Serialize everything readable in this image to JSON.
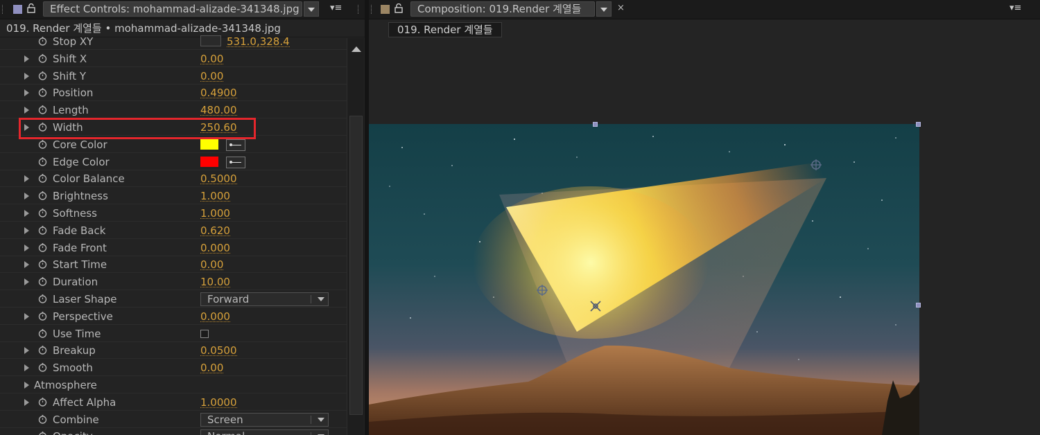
{
  "effect_controls": {
    "tab_title": "Effect Controls: mohammad-alizade-341348.jpg",
    "subheader": "019. Render 계열들 • mohammad-alizade-341348.jpg",
    "properties": [
      {
        "label": "Stop XY",
        "value": "531.0,328.4",
        "kind": "point",
        "expandable": false
      },
      {
        "label": "Shift X",
        "value": "0.00",
        "kind": "number",
        "expandable": true
      },
      {
        "label": "Shift Y",
        "value": "0.00",
        "kind": "number",
        "expandable": true
      },
      {
        "label": "Position",
        "value": "0.4900",
        "kind": "number",
        "expandable": true
      },
      {
        "label": "Length",
        "value": "480.00",
        "kind": "number",
        "expandable": true
      },
      {
        "label": "Width",
        "value": "250.60",
        "kind": "number",
        "expandable": true
      },
      {
        "label": "Core Color",
        "value": "#ffff00",
        "kind": "color",
        "expandable": false
      },
      {
        "label": "Edge Color",
        "value": "#ff0000",
        "kind": "color",
        "expandable": false
      },
      {
        "label": "Color Balance",
        "value": "0.5000",
        "kind": "number",
        "expandable": true
      },
      {
        "label": "Brightness",
        "value": "1.000",
        "kind": "number",
        "expandable": true
      },
      {
        "label": "Softness",
        "value": "1.000",
        "kind": "number",
        "expandable": true
      },
      {
        "label": "Fade Back",
        "value": "0.620",
        "kind": "number",
        "expandable": true
      },
      {
        "label": "Fade Front",
        "value": "0.000",
        "kind": "number",
        "expandable": true
      },
      {
        "label": "Start Time",
        "value": "0.00",
        "kind": "number",
        "expandable": true
      },
      {
        "label": "Duration",
        "value": "10.00",
        "kind": "number",
        "expandable": true
      },
      {
        "label": "Laser Shape",
        "value": "Forward",
        "kind": "dropdown",
        "expandable": false
      },
      {
        "label": "Perspective",
        "value": "0.000",
        "kind": "number",
        "expandable": true
      },
      {
        "label": "Use Time",
        "value": "",
        "kind": "checkbox",
        "expandable": false
      },
      {
        "label": "Breakup",
        "value": "0.0500",
        "kind": "number",
        "expandable": true
      },
      {
        "label": "Smooth",
        "value": "0.00",
        "kind": "number",
        "expandable": true
      },
      {
        "label": "Atmosphere",
        "value": "",
        "kind": "group",
        "expandable": true
      },
      {
        "label": "Affect Alpha",
        "value": "1.0000",
        "kind": "number",
        "expandable": true
      },
      {
        "label": "Combine",
        "value": "Screen",
        "kind": "dropdown",
        "expandable": false
      },
      {
        "label": "Opacity",
        "value": "Normal",
        "kind": "dropdown",
        "expandable": false
      }
    ],
    "highlighted_property": "Width"
  },
  "composition": {
    "tab_title": "Composition: 019.Render 계열들",
    "chip_label": "019. Render 계열들"
  },
  "colors": {
    "value_orange": "#d7a13a",
    "highlight_red": "#e4262c",
    "panel_bg": "#232323",
    "core_color": "#ffff00",
    "edge_color": "#ff0000"
  }
}
